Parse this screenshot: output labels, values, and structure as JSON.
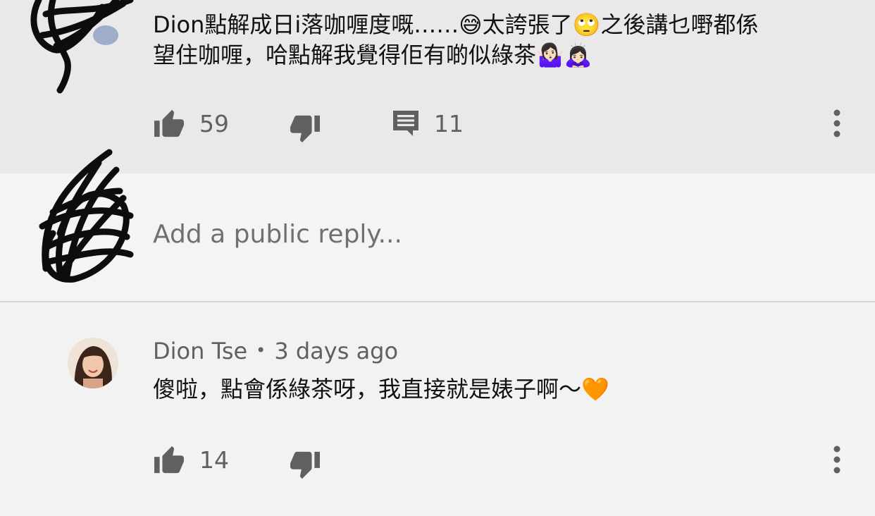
{
  "top_comment": {
    "text_line1": "Dion點解成日i落咖喱度嘅……😅太誇張了🙄之後講乜嘢都係",
    "text_line2": "望住咖喱，哈點解我覺得佢有啲似綠茶🤷🏻‍♀️🙇🏻‍♀️",
    "likes": "59",
    "replies": "11"
  },
  "reply_input": {
    "placeholder": "Add a public reply..."
  },
  "reply": {
    "author": "Dion Tse",
    "separator": "•",
    "time": "3 days ago",
    "text": "傻啦，點會係綠茶呀，我直接就是婊子啊～🧡",
    "likes": "14"
  },
  "icons": {
    "like": "thumb-up-icon",
    "dislike": "thumb-down-icon",
    "comment": "comment-icon",
    "more": "more-vertical-icon"
  },
  "colors": {
    "top_bg": "#e9e9e9",
    "page_bg": "#f2f2f2",
    "icon_gray": "#606060"
  }
}
